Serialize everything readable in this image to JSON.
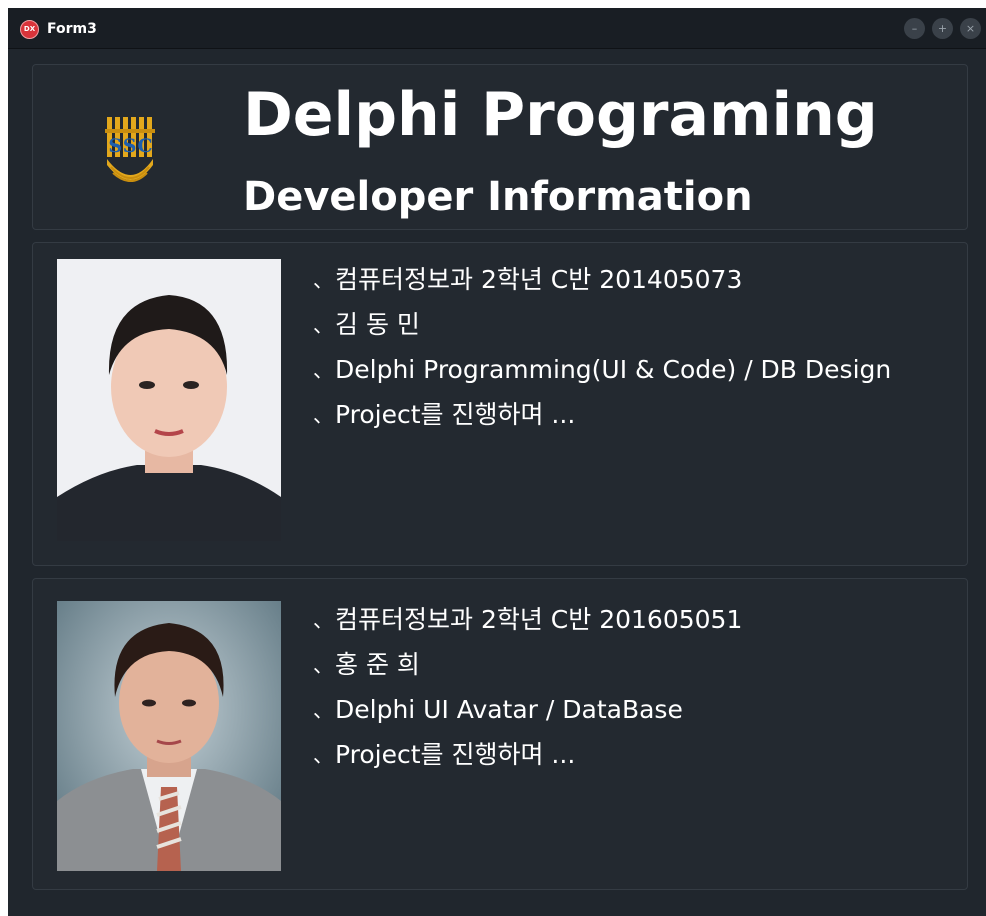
{
  "window": {
    "title": "Form3",
    "icon_label": "DX",
    "controls": {
      "minimize": "–",
      "maximize": "+",
      "close": "×"
    }
  },
  "header": {
    "logo_text": "SSC",
    "title": "Delphi Programing",
    "subtitle": "Developer Information"
  },
  "developers": [
    {
      "photo_icon": "profile-photo",
      "lines": [
        "컴퓨터정보과 2학년 C반 201405073",
        "김 동 민",
        "Delphi Programming(UI & Code) / DB Design",
        "Project를 진행하며 ..."
      ]
    },
    {
      "photo_icon": "profile-photo",
      "lines": [
        "컴퓨터정보과 2학년 C반 201605051",
        "홍 준 희",
        "Delphi UI Avatar / DataBase",
        "Project를 진행하며 ..."
      ]
    }
  ],
  "bullet": "、",
  "colors": {
    "window_bg": "#20262d",
    "titlebar_bg": "#191e24",
    "panel_border": "#343b43",
    "text": "#ffffff",
    "icon_red": "#d8343b",
    "logo_gold": "#e3a81c",
    "logo_blue": "#1d5fae"
  }
}
